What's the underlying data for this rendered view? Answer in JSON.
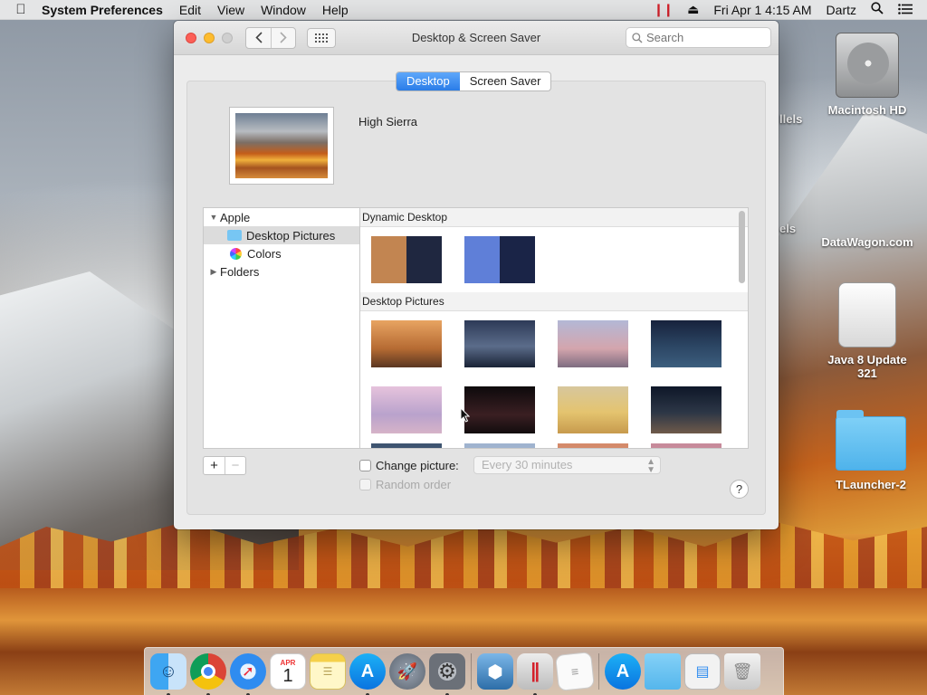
{
  "menubar": {
    "app_name": "System Preferences",
    "menus": [
      "Edit",
      "View",
      "Window",
      "Help"
    ],
    "clock": "Fri Apr 1  4:15 AM",
    "user": "Dartz"
  },
  "desktop": {
    "icons": [
      {
        "label": "Macintosh HD"
      },
      {
        "label": "DataWagon.com"
      },
      {
        "label": "Java 8 Update 321"
      },
      {
        "label": "TLauncher-2"
      }
    ],
    "partial_labels": [
      "llels",
      "els"
    ]
  },
  "window": {
    "title": "Desktop & Screen Saver",
    "search_placeholder": "Search",
    "tabs": [
      {
        "label": "Desktop",
        "active": true
      },
      {
        "label": "Screen Saver",
        "active": false
      }
    ],
    "current_wallpaper": "High Sierra",
    "source_list": [
      {
        "label": "Apple",
        "expanded": true
      },
      {
        "label": "Desktop Pictures",
        "selected": true
      },
      {
        "label": "Colors"
      },
      {
        "label": "Folders",
        "expanded": false
      }
    ],
    "sections": [
      {
        "title": "Dynamic Desktop"
      },
      {
        "title": "Desktop Pictures"
      }
    ],
    "add_button": "+",
    "remove_button": "−",
    "change_picture_label": "Change picture:",
    "change_picture_checked": false,
    "interval_value": "Every 30 minutes",
    "random_order_label": "Random order",
    "help_label": "?"
  },
  "dock": {
    "apps": [
      "Finder",
      "Chrome",
      "Safari",
      "Calendar",
      "Notes",
      "App Store",
      "Launchpad",
      "System Preferences",
      "VirtualBox",
      "Parallels",
      "TextEdit",
      "App Store",
      "Folder",
      "Preview",
      "Trash"
    ],
    "calendar_month": "APR",
    "calendar_day": "1"
  },
  "colors": {
    "accent": "#2a7de8",
    "close": "#fc5f57",
    "minimize": "#fdbc2e"
  }
}
